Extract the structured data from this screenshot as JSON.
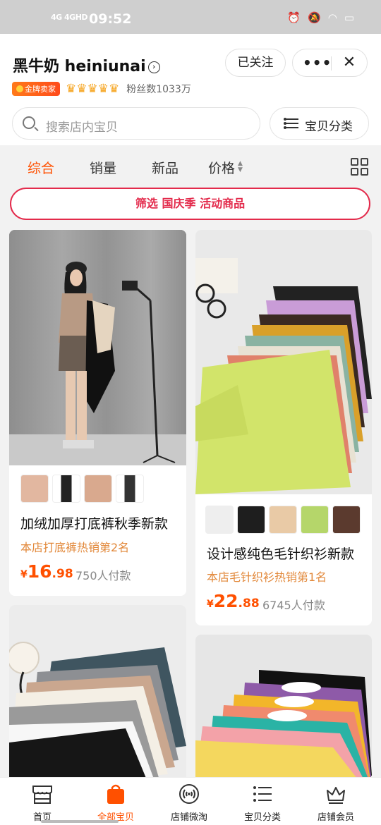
{
  "status_bar": {
    "signal": "4G 4GHD",
    "time": "09:52"
  },
  "shop": {
    "name": "黑牛奶 heiniunai",
    "badge": "金牌卖家",
    "fans": "粉丝数1033万",
    "follow_label": "已关注",
    "more_label": "•••",
    "close_label": "✕"
  },
  "search": {
    "placeholder": "搜索店内宝贝"
  },
  "category_button": {
    "label": "宝贝分类"
  },
  "tabs": [
    {
      "label": "综合",
      "active": true
    },
    {
      "label": "销量"
    },
    {
      "label": "新品"
    },
    {
      "label": "价格"
    }
  ],
  "filter_label": "筛选 国庆季 活动商品",
  "products": [
    {
      "title": "加绒加厚打底裤秋季新款",
      "rank": "本店打底裤热销第2名",
      "price_int": "16",
      "price_dec": ".98",
      "currency": "¥",
      "sold": "750人付款"
    },
    {
      "title": "设计感纯色毛针织衫新款",
      "rank": "本店毛针织衫热销第1名",
      "price_int": "22",
      "price_dec": ".88",
      "currency": "¥",
      "sold": "6745人付款"
    }
  ],
  "nav": [
    {
      "label": "首页",
      "icon": "shop-icon"
    },
    {
      "label": "全部宝贝",
      "icon": "bag-icon",
      "active": true
    },
    {
      "label": "店铺微淘",
      "icon": "broadcast-icon"
    },
    {
      "label": "宝贝分类",
      "icon": "list-icon"
    },
    {
      "label": "店铺会员",
      "icon": "crown-icon"
    }
  ],
  "colors": {
    "accent": "#ff5000",
    "filter": "#e32a4b",
    "rank": "#e2883a"
  }
}
